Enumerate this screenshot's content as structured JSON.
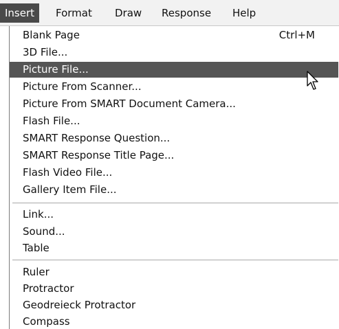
{
  "menubar": {
    "items": [
      {
        "label": "Insert"
      },
      {
        "label": "Format"
      },
      {
        "label": "Draw"
      },
      {
        "label": "Response"
      },
      {
        "label": "Help"
      }
    ]
  },
  "menu": {
    "items": [
      {
        "label": "Blank Page",
        "shortcut": "Ctrl+M"
      },
      {
        "label": "3D File..."
      },
      {
        "label": "Picture File..."
      },
      {
        "label": "Picture From Scanner..."
      },
      {
        "label": "Picture From SMART Document Camera..."
      },
      {
        "label": "Flash File..."
      },
      {
        "label": "SMART Response Question..."
      },
      {
        "label": "SMART Response Title Page..."
      },
      {
        "label": "Flash Video File..."
      },
      {
        "label": "Gallery Item File..."
      },
      {
        "label": "Link..."
      },
      {
        "label": "Sound..."
      },
      {
        "label": "Table"
      },
      {
        "label": "Ruler"
      },
      {
        "label": "Protractor"
      },
      {
        "label": "Geodreieck Protractor"
      },
      {
        "label": "Compass"
      }
    ]
  },
  "cursor": {
    "icon": "mouse-pointer-icon"
  },
  "colors": {
    "active_menu_bg": "#4a4a4a",
    "highlight_bg": "#555555",
    "menubar_bg": "#f2f2f2"
  }
}
